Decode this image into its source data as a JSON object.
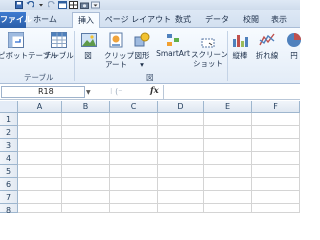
{
  "quick_access": {
    "icons": [
      "app-icon",
      "save-icon",
      "undo-icon",
      "redo-icon",
      "customize-icon"
    ]
  },
  "tabs": [
    {
      "label": "ファイル"
    },
    {
      "label": "ホーム"
    },
    {
      "label": "挿入"
    },
    {
      "label": "ページ レイアウト"
    },
    {
      "label": "数式"
    },
    {
      "label": "データ"
    },
    {
      "label": "校閲"
    },
    {
      "label": "表示"
    }
  ],
  "active_tab": "挿入",
  "ribbon": {
    "table_group": {
      "label": "テーブル",
      "pivot_table": "ピボットテーブル",
      "table": "テーブル"
    },
    "illustrations_group": {
      "picture": "図",
      "clip_art_line1": "クリップ",
      "clip_art_line2": "アート",
      "shapes_line1": "図形",
      "smartart": "SmartArt",
      "screenshot_line1": "スクリーン",
      "screenshot_line2": "ショット"
    },
    "charts_group": {
      "column": "縦棒",
      "line": "折れ線",
      "pie": "円"
    }
  },
  "formula_bar": {
    "name_box": "R18",
    "fx": "fx",
    "formula": ""
  },
  "grid": {
    "columns": [
      "A",
      "B",
      "C",
      "D",
      "E",
      "F"
    ],
    "rows": [
      "1",
      "2",
      "3",
      "4",
      "5",
      "6",
      "7",
      "8"
    ]
  },
  "colors": {
    "file_tab": "#2a5ea9",
    "ribbon_bg": "#e3ecf7",
    "header_bg": "#dfe7f1",
    "gridline": "#d4d4d4"
  }
}
